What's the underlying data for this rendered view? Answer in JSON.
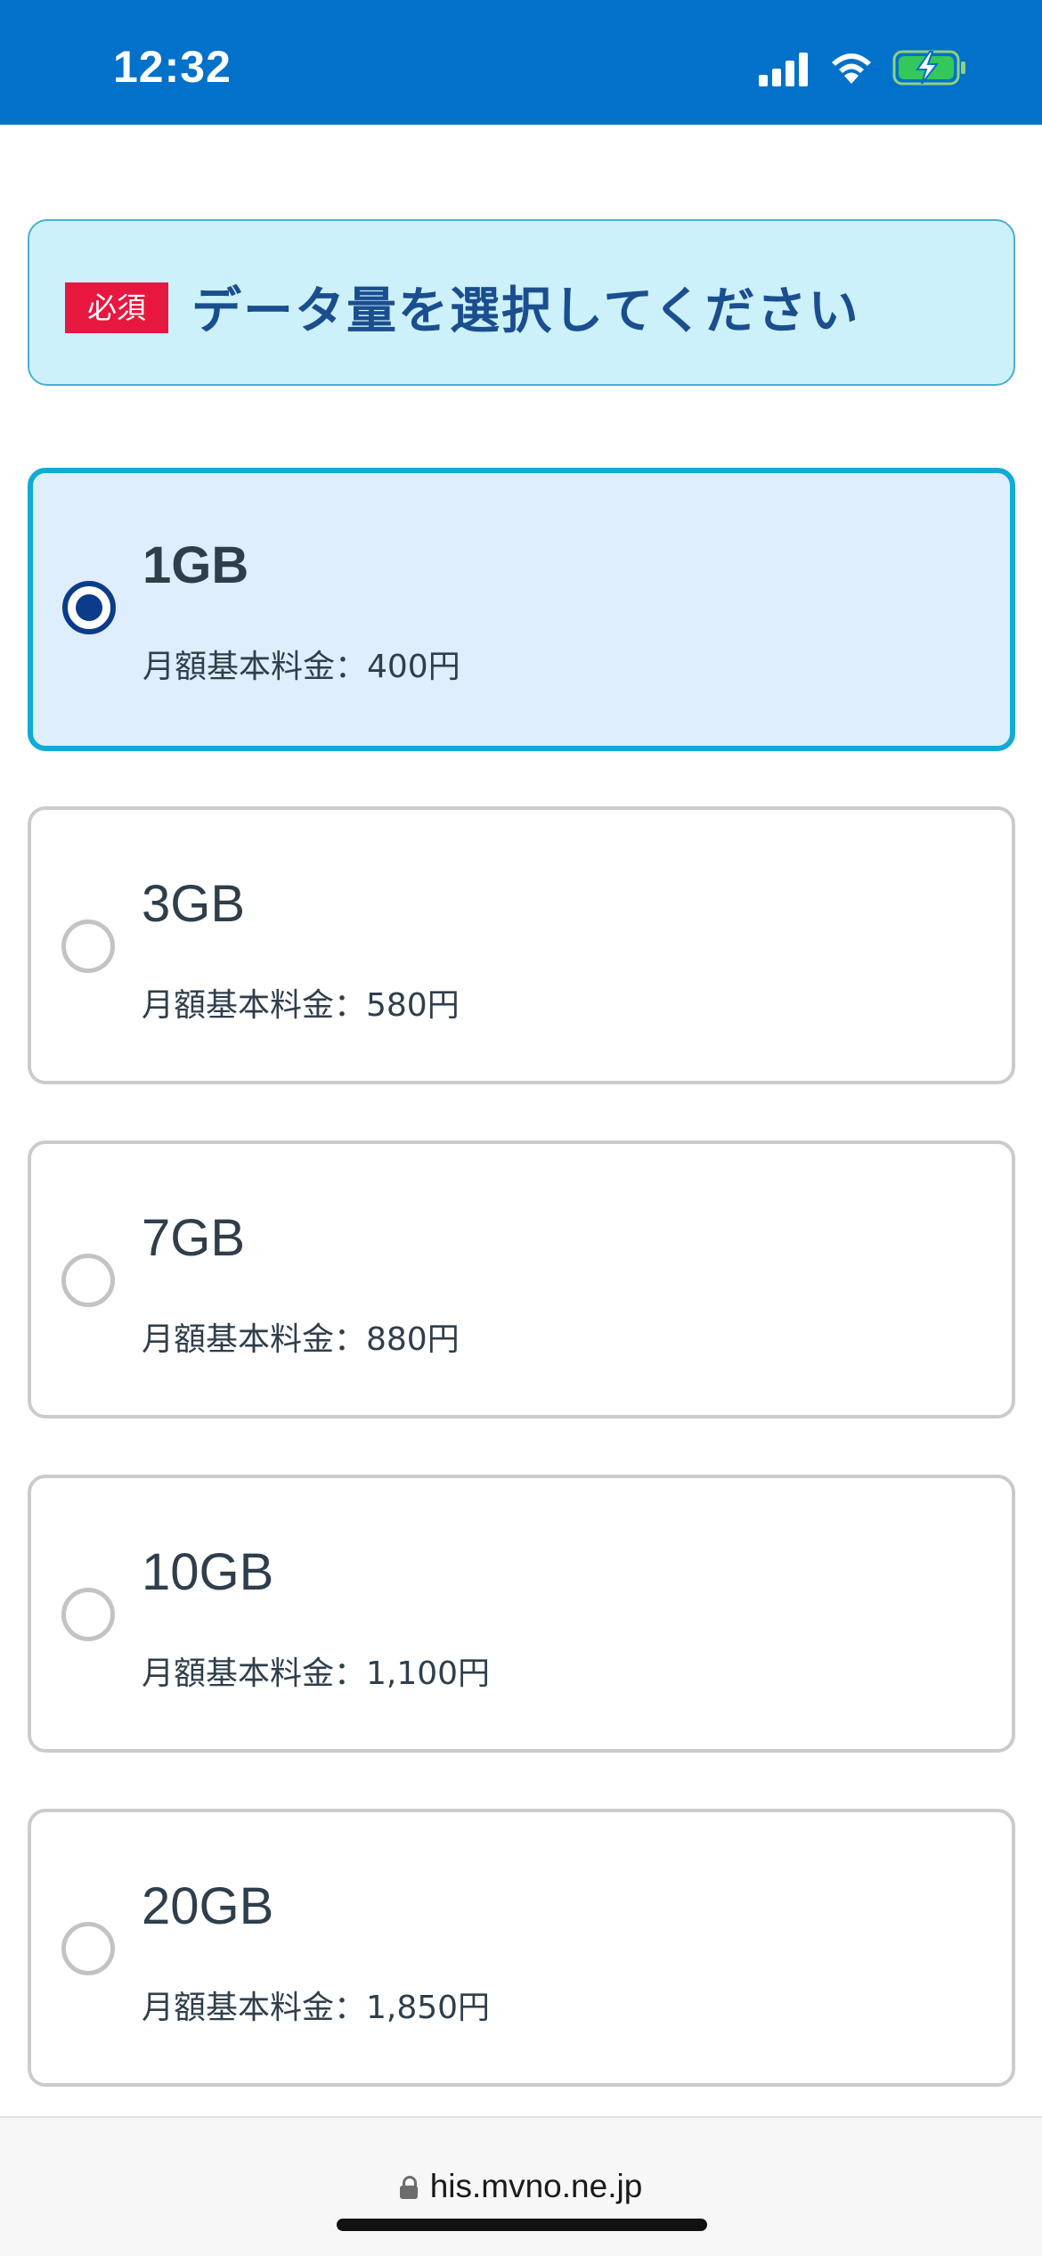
{
  "status_bar": {
    "time": "12:32",
    "background_color": "#0171c9",
    "icons": [
      "cellular-signal-icon",
      "wifi-icon",
      "battery-charging-icon"
    ]
  },
  "form": {
    "required_badge": "必須",
    "title": "データ量を選択してください",
    "selected_index": 0,
    "options": [
      {
        "gb": "1GB",
        "price": "月額基本料金：400円",
        "selected": true
      },
      {
        "gb": "3GB",
        "price": "月額基本料金：580円",
        "selected": false
      },
      {
        "gb": "7GB",
        "price": "月額基本料金：880円",
        "selected": false
      },
      {
        "gb": "10GB",
        "price": "月額基本料金：1,100円",
        "selected": false
      },
      {
        "gb": "20GB",
        "price": "月額基本料金：1,850円",
        "selected": false
      }
    ]
  },
  "browser": {
    "url": "his.mvno.ne.jp"
  },
  "colors": {
    "accent_blue": "#0171c9",
    "badge_red": "#e8173f",
    "selected_border": "#10acd6",
    "selected_fill": "#deeefd",
    "title_text": "#1b4e8f"
  }
}
